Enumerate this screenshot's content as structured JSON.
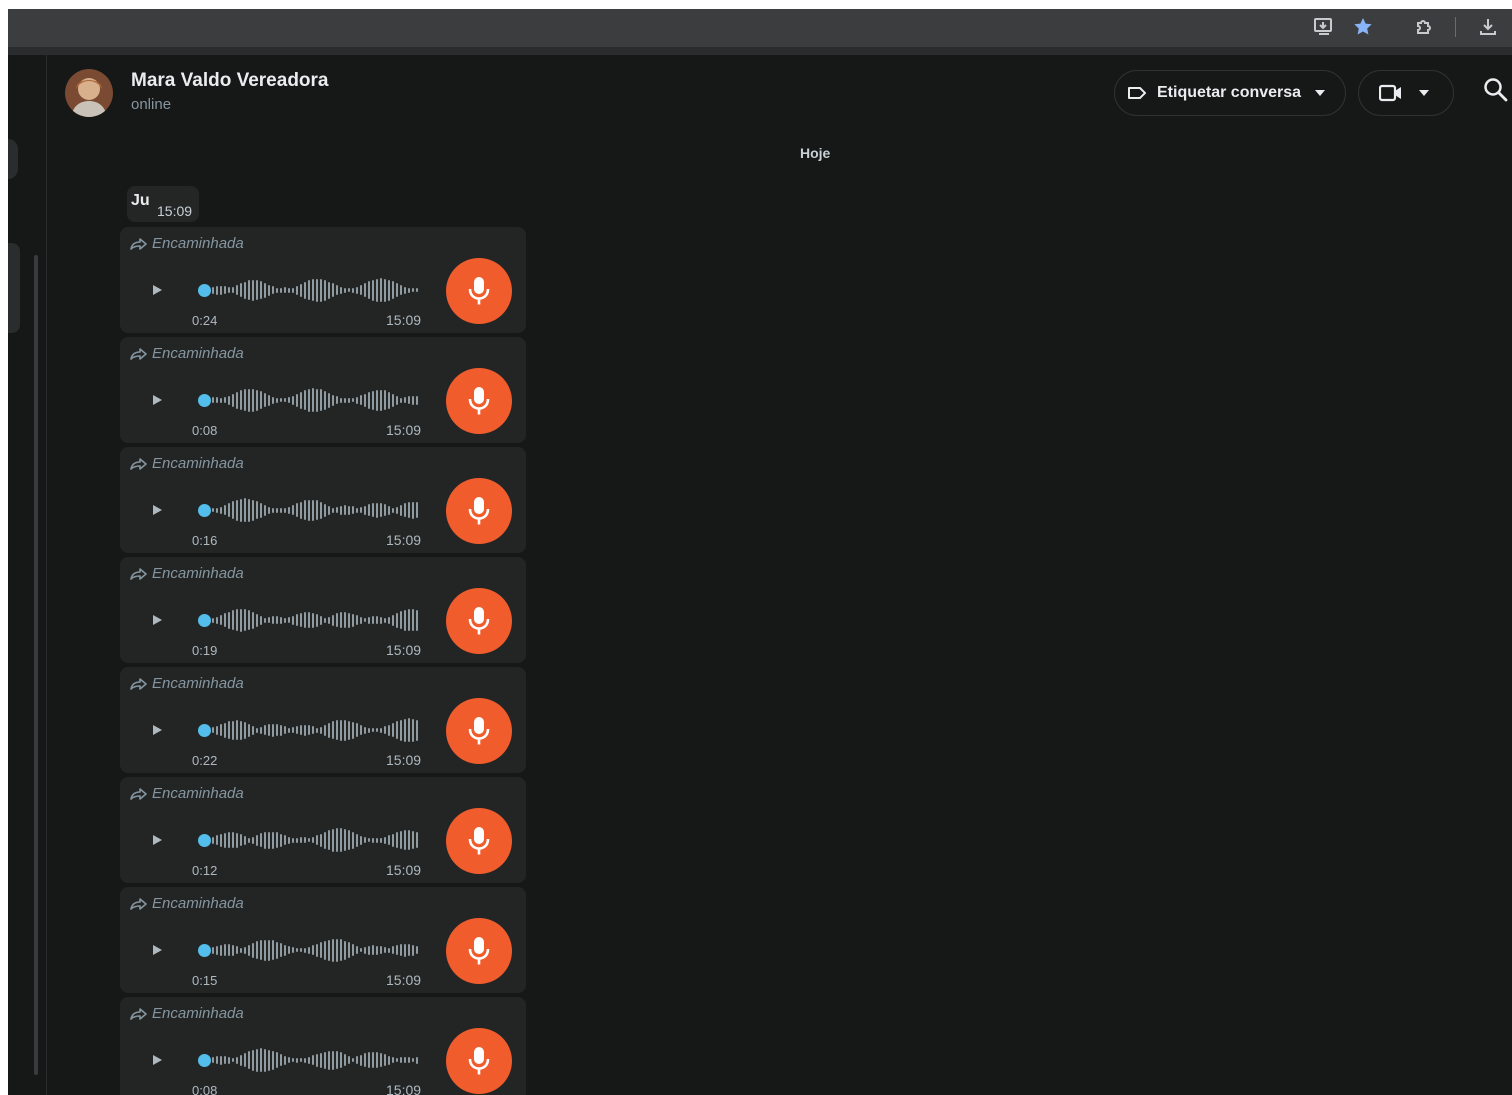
{
  "browser": {
    "icons": [
      "install-app-icon",
      "bookmark-star-icon",
      "extensions-icon",
      "download-icon"
    ],
    "accent": "#8ab4f8"
  },
  "header": {
    "contact_name": "Mara Valdo Vereadora",
    "status": "online",
    "label_button": "Etiquetar conversa",
    "icons": [
      "label-icon",
      "chevron-down-icon",
      "video-call-icon",
      "search-icon"
    ]
  },
  "chat": {
    "day_separator": "Hoje",
    "sender_message": {
      "text": "Ju",
      "time": "15:09"
    },
    "voice_messages": [
      {
        "forward_label": "Encaminhada",
        "duration": "0:24",
        "time": "15:09"
      },
      {
        "forward_label": "Encaminhada",
        "duration": "0:08",
        "time": "15:09"
      },
      {
        "forward_label": "Encaminhada",
        "duration": "0:16",
        "time": "15:09"
      },
      {
        "forward_label": "Encaminhada",
        "duration": "0:19",
        "time": "15:09"
      },
      {
        "forward_label": "Encaminhada",
        "duration": "0:22",
        "time": "15:09"
      },
      {
        "forward_label": "Encaminhada",
        "duration": "0:12",
        "time": "15:09"
      },
      {
        "forward_label": "Encaminhada",
        "duration": "0:15",
        "time": "15:09"
      },
      {
        "forward_label": "Encaminhada",
        "duration": "0:08",
        "time": "15:09"
      }
    ]
  },
  "colors": {
    "background": "#161717",
    "bubble": "#232525",
    "mic_badge": "#f15c2d",
    "progress_dot": "#53bdeb"
  }
}
